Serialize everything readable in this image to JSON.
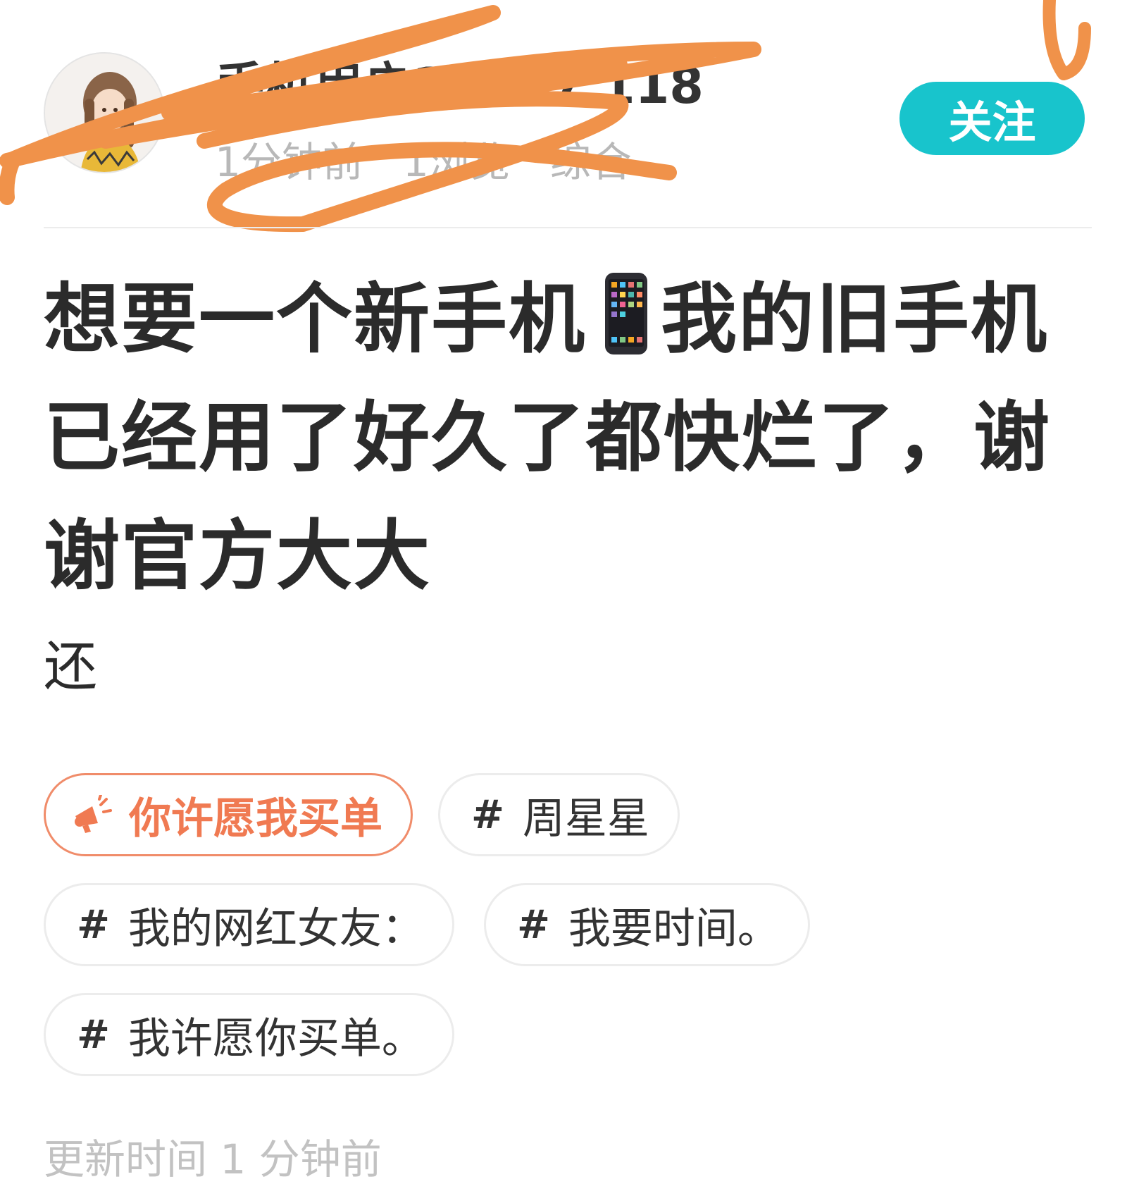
{
  "header": {
    "username": "手机用户11047 118",
    "meta": {
      "time": "1分钟前",
      "views": "1浏览",
      "category": "综合"
    },
    "follow_label": "关注"
  },
  "post": {
    "title_part1": "想要一个新手机",
    "title_part2": "我的旧手机已经用了好久了都快烂了，谢谢官方大大",
    "body": "还"
  },
  "tags": [
    {
      "label": "你许愿我买单",
      "type": "activity",
      "icon": "megaphone-icon"
    },
    {
      "label": "周星星",
      "type": "topic",
      "prefix": "#"
    },
    {
      "label": "我的网红女友：",
      "type": "topic",
      "prefix": "#"
    },
    {
      "label": "我要时间。",
      "type": "topic",
      "prefix": "#"
    },
    {
      "label": "我许愿你买单。",
      "type": "topic",
      "prefix": "#"
    }
  ],
  "footer": {
    "update_time": "更新时间 1 分钟前"
  },
  "colors": {
    "accent_teal": "#18c4cc",
    "activity_orange": "#f07a52",
    "scribble_orange": "#f0924a",
    "meta_gray": "#b8b8b8"
  }
}
